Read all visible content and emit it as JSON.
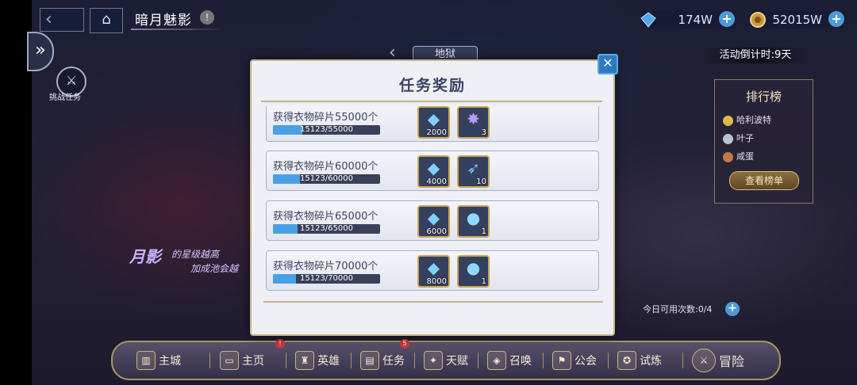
{
  "header": {
    "back_icon": "back-arrow-icon",
    "home_icon": "home-icon",
    "title": "暗月魅影",
    "info": "!"
  },
  "resources": {
    "gems": "174W",
    "coins": "52015W",
    "plus": "+"
  },
  "countdown": "活动倒计时:9天",
  "side": {
    "toggle": "»",
    "challenge_label": "挑战任务"
  },
  "hell_tab": "地狱",
  "promo": {
    "line1": "月影",
    "line2": "的星级越高",
    "line3": "加成池会越"
  },
  "ranking": {
    "title": "排行榜",
    "entries": [
      "哈利波特",
      "叶子",
      "咸蛋"
    ],
    "button": "查看榜单"
  },
  "daily": {
    "text": "今日可用次数:0/4",
    "plus": "+"
  },
  "modal": {
    "title": "任务奖励",
    "close": "✕",
    "rows": [
      {
        "label": "获得衣物碎片55000个",
        "progress": "15123/55000",
        "fraction": 0.275,
        "rewards": [
          {
            "icon": "diamond-icon",
            "count": "2000"
          },
          {
            "icon": "crystal-cluster-icon",
            "count": "3"
          }
        ]
      },
      {
        "label": "获得衣物碎片60000个",
        "progress": "15123/60000",
        "fraction": 0.252,
        "rewards": [
          {
            "icon": "diamond-icon",
            "count": "4000"
          },
          {
            "icon": "blue-shard-icon",
            "count": "10"
          }
        ]
      },
      {
        "label": "获得衣物碎片65000个",
        "progress": "15123/65000",
        "fraction": 0.233,
        "rewards": [
          {
            "icon": "diamond-icon",
            "count": "6000"
          },
          {
            "icon": "blue-orb-icon",
            "count": "1"
          }
        ]
      },
      {
        "label": "获得衣物碎片70000个",
        "progress": "15123/70000",
        "fraction": 0.216,
        "rewards": [
          {
            "icon": "diamond-icon",
            "count": "8000"
          },
          {
            "icon": "blue-orb-icon",
            "count": "1"
          }
        ]
      }
    ]
  },
  "nav": {
    "items": [
      {
        "label": "主城",
        "icon": "castle-icon"
      },
      {
        "label": "主页",
        "icon": "banner-icon",
        "badge": "!"
      },
      {
        "label": "英雄",
        "icon": "helmet-icon"
      },
      {
        "label": "任务",
        "icon": "scroll-icon",
        "badge": "5"
      },
      {
        "label": "天赋",
        "icon": "talent-icon"
      },
      {
        "label": "召唤",
        "icon": "summon-icon"
      },
      {
        "label": "公会",
        "icon": "guild-icon"
      },
      {
        "label": "试炼",
        "icon": "trial-icon"
      },
      {
        "label": "冒险",
        "icon": "adventure-icon"
      }
    ]
  }
}
